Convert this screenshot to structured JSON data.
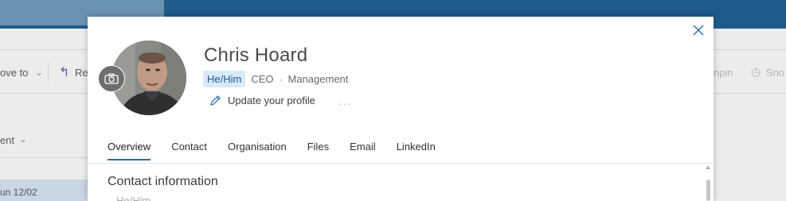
{
  "background": {
    "move_to": "ove to",
    "reply": "Re",
    "unpin": "npin",
    "snooze": "Sno",
    "sort": "ent",
    "date": "un 12/02"
  },
  "profile": {
    "name": "Chris Hoard",
    "pronouns": "He/Him",
    "role": "CEO",
    "separator": "·",
    "department": "Management",
    "update_label": "Update your profile",
    "more_label": "···"
  },
  "tabs": [
    {
      "label": "Overview",
      "active": true
    },
    {
      "label": "Contact"
    },
    {
      "label": "Organisation"
    },
    {
      "label": "Files"
    },
    {
      "label": "Email"
    },
    {
      "label": "LinkedIn"
    }
  ],
  "section": {
    "title": "Contact information",
    "peek": "He/Him"
  },
  "colors": {
    "accent": "#2b6cb0",
    "pronoun_bg": "#dbe9f7",
    "pronoun_text": "#1e5a96"
  }
}
